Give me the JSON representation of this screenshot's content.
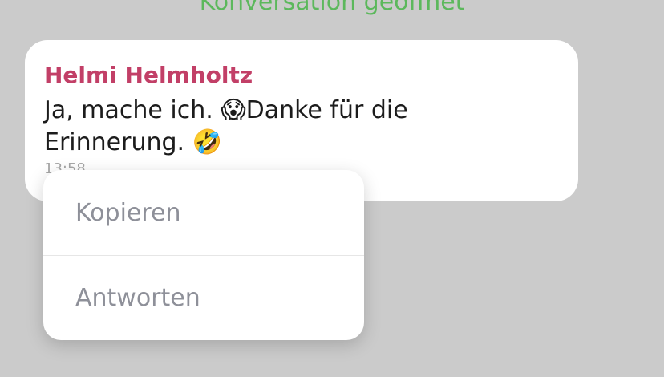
{
  "system_message": "Konversation geöffnet",
  "chat_message": {
    "sender": "Helmi Helmholtz",
    "text": "Ja, mache ich. 😱Danke für die Erinnerung. 🤣",
    "time": "13:58"
  },
  "context_menu": {
    "items": [
      "Kopieren",
      "Antworten"
    ]
  },
  "colors": {
    "background": "#cbcbcb",
    "system_message": "#5cb85c",
    "sender_name": "#c23f67",
    "menu_text": "#8e9099"
  }
}
